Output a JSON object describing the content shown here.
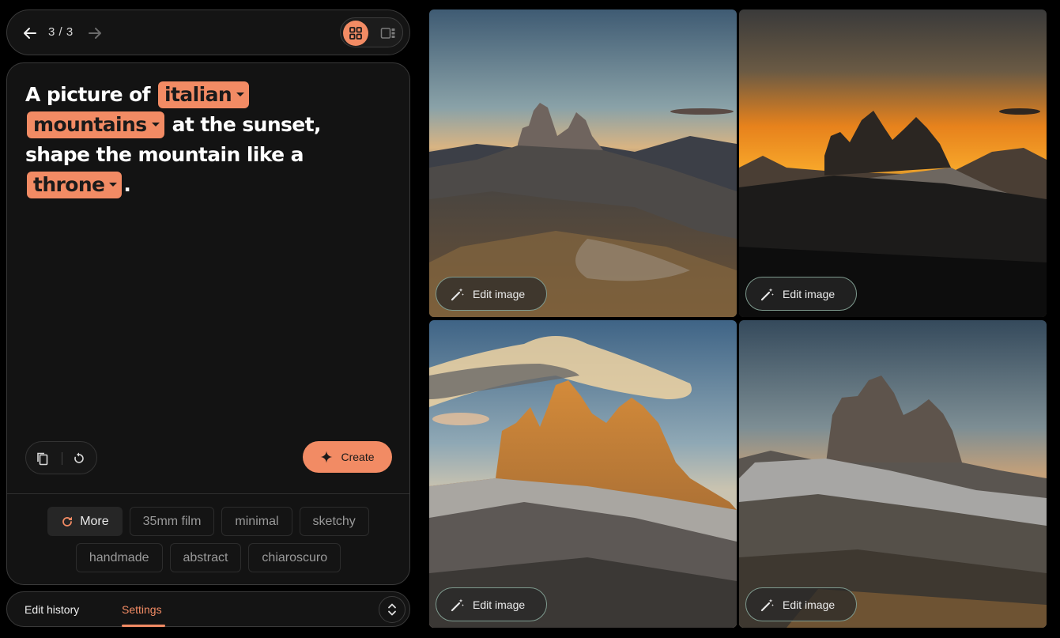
{
  "nav": {
    "counter": "3 / 3",
    "back_icon": "arrow-left-icon",
    "forward_icon": "arrow-right-icon",
    "grid_view_icon": "grid-icon",
    "single_view_icon": "single-view-icon"
  },
  "prompt": {
    "segments": {
      "t1": "A picture of",
      "chip1": "italian",
      "chip2": "mountains",
      "t2": "at the sunset, shape the mountain like a",
      "chip3": "throne",
      "t3": "."
    }
  },
  "actions": {
    "copy_icon": "copy-icon",
    "reset_icon": "reset-icon",
    "create_label": "Create",
    "create_icon": "sparkle-icon"
  },
  "style_chips": {
    "more_label": "More",
    "row1": [
      "35mm film",
      "minimal",
      "sketchy"
    ],
    "row2": [
      "handmade",
      "abstract",
      "chiaroscuro"
    ]
  },
  "tabs": {
    "history_label": "Edit history",
    "settings_label": "Settings",
    "active": "Settings",
    "expand_icon": "unfold-icon"
  },
  "images": {
    "edit_label": "Edit image",
    "edit_icon": "magic-wand-icon"
  },
  "colors": {
    "accent": "#f28b64",
    "background": "#000000",
    "card": "#131313"
  }
}
